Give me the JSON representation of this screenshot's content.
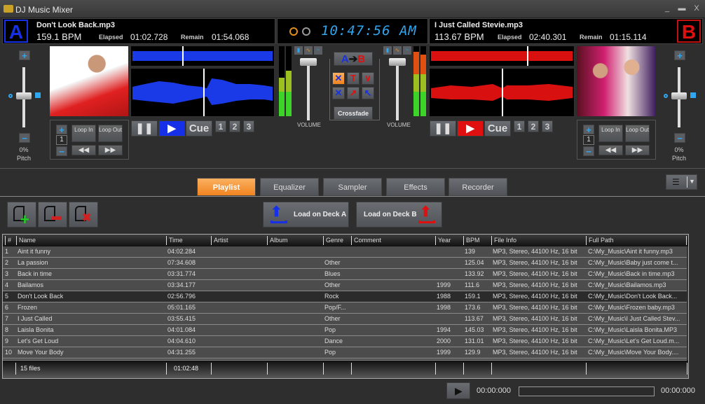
{
  "window": {
    "title": "DJ Music Mixer",
    "controls": [
      "minimize",
      "maximize",
      "close"
    ]
  },
  "deckA": {
    "label": "A",
    "color": "#1530e6",
    "track": "Don't Look Back.mp3",
    "bpm": "159.1 BPM",
    "elapsed_label": "Elapsed",
    "elapsed": "01:02.728",
    "remain_label": "Remain",
    "remain": "01:54.068",
    "pitch_value": "0%",
    "pitch_label": "Pitch",
    "loop_count": "1",
    "loop_in": "Loop In",
    "loop_out": "Loop Out",
    "cue": "Cue",
    "hotcues": [
      "1",
      "2",
      "3"
    ],
    "volume_label": "VOLUME"
  },
  "deckB": {
    "label": "B",
    "color": "#e01010",
    "track": "I Just Called  Stevie.mp3",
    "bpm": "113.67 BPM",
    "elapsed_label": "Elapsed",
    "elapsed": "02:40.301",
    "remain_label": "Remain",
    "remain": "01:15.114",
    "pitch_value": "0%",
    "pitch_label": "Pitch",
    "loop_count": "1",
    "loop_in": "Loop In",
    "loop_out": "Loop Out",
    "cue": "Cue",
    "hotcues": [
      "1",
      "2",
      "3"
    ],
    "volume_label": "VOLUME"
  },
  "clock": {
    "time": "10:47:56 AM"
  },
  "mixer": {
    "direction_a": "A",
    "direction_b": "B",
    "crossfade_label": "Crossfade"
  },
  "tabs": [
    {
      "label": "Playlist",
      "active": true
    },
    {
      "label": "Equalizer",
      "active": false
    },
    {
      "label": "Sampler",
      "active": false
    },
    {
      "label": "Effects",
      "active": false
    },
    {
      "label": "Recorder",
      "active": false
    }
  ],
  "toolbar": {
    "load_a": "Load on Deck A",
    "load_b": "Load on Deck B"
  },
  "playlist": {
    "columns": [
      "#",
      "Name",
      "Time",
      "Artist",
      "Album",
      "Genre",
      "Comment",
      "Year",
      "BPM",
      "File Info",
      "Full Path"
    ],
    "rows": [
      {
        "n": "1",
        "name": "Aint it funny",
        "time": "04:02.284",
        "genre": "",
        "year": "",
        "bpm": "139",
        "info": "MP3, Stereo, 44100 Hz, 16 bit",
        "path": "C:\\My_Music\\Aint it funny.mp3"
      },
      {
        "n": "2",
        "name": "La passion",
        "time": "07:34.608",
        "genre": "Other",
        "year": "",
        "bpm": "125.04",
        "info": "MP3, Stereo, 44100 Hz, 16 bit",
        "path": "C:\\My_Music\\Baby just come t..."
      },
      {
        "n": "3",
        "name": "Back in time",
        "time": "03:31.774",
        "genre": "Blues",
        "year": "",
        "bpm": "133.92",
        "info": "MP3, Stereo, 44100 Hz, 16 bit",
        "path": "C:\\My_Music\\Back in time.mp3"
      },
      {
        "n": "4",
        "name": "Bailamos",
        "time": "03:34.177",
        "genre": "Other",
        "year": "1999",
        "bpm": "111.6",
        "info": "MP3, Stereo, 44100 Hz, 16 bit",
        "path": "C:\\My_Music\\Bailamos.mp3"
      },
      {
        "n": "5",
        "name": "Don't Look Back",
        "time": "02:56.796",
        "genre": "Rock",
        "year": "1988",
        "bpm": "159.1",
        "info": "MP3, Stereo, 44100 Hz, 16 bit",
        "path": "C:\\My_Music\\Don't Look Back..."
      },
      {
        "n": "6",
        "name": "Frozen",
        "time": "05:01.165",
        "genre": "Pop/F...",
        "year": "1998",
        "bpm": "173.6",
        "info": "MP3, Stereo, 44100 Hz, 16 bit",
        "path": "C:\\My_Music\\Frozen baby.mp3"
      },
      {
        "n": "7",
        "name": "I Just Called",
        "time": "03:55.415",
        "genre": "Other",
        "year": "",
        "bpm": "113.67",
        "info": "MP3, Stereo, 44100 Hz, 16 bit",
        "path": "C:\\My_Music\\I Just Called  Stev..."
      },
      {
        "n": "8",
        "name": "Laisla Bonita",
        "time": "04:01.084",
        "genre": "Pop",
        "year": "1994",
        "bpm": "145.03",
        "info": "MP3, Stereo, 44100 Hz, 16 bit",
        "path": "C:\\My_Music\\Laisla Bonita.MP3"
      },
      {
        "n": "9",
        "name": "Let's Get Loud",
        "time": "04:04.610",
        "genre": "Dance",
        "year": "2000",
        "bpm": "131.01",
        "info": "MP3, Stereo, 44100 Hz, 16 bit",
        "path": "C:\\My_Music\\Let's Get Loud.m..."
      },
      {
        "n": "10",
        "name": "Move Your Body",
        "time": "04:31.255",
        "genre": "Pop",
        "year": "1999",
        "bpm": "129.9",
        "info": "MP3, Stereo, 44100 Hz, 16 bit",
        "path": "C:\\My_Music\\Move Your Body...."
      }
    ],
    "selected_row": 5,
    "footer": {
      "count": "15 files",
      "total_time": "01:02:48"
    }
  },
  "preview_player": {
    "current": "00:00:000",
    "total": "00:00:000",
    "progress": 0
  }
}
